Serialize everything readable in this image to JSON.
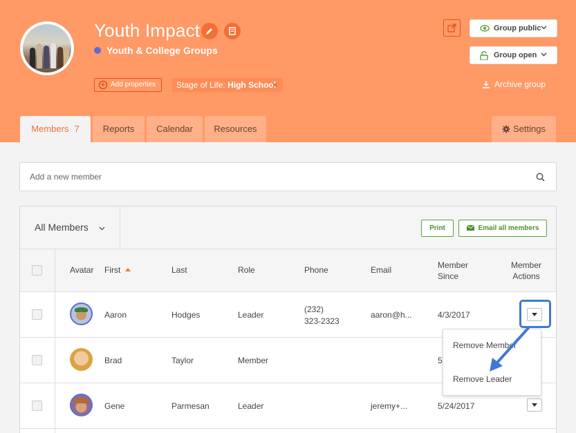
{
  "group": {
    "title": "Youth Impact",
    "category": "Youth & College Groups",
    "add_properties": "Add properties",
    "tag_label": "Stage of Life:",
    "tag_value": "High School",
    "tag_remove": "×",
    "visibility": "Group public",
    "status": "Group open",
    "archive": "Archive group"
  },
  "tabs": [
    {
      "label": "Members",
      "count": "7"
    },
    {
      "label": "Reports"
    },
    {
      "label": "Calendar"
    },
    {
      "label": "Resources"
    },
    {
      "label": "Settings"
    }
  ],
  "add_member_placeholder": "Add a new member",
  "toolbar": {
    "filter": "All Members",
    "print": "Print",
    "email_all": "Email all members"
  },
  "columns": {
    "avatar": "Avatar",
    "first": "First",
    "last": "Last",
    "role": "Role",
    "phone": "Phone",
    "email": "Email",
    "member_since_1": "Member",
    "member_since_2": "Since",
    "actions_1": "Member",
    "actions_2": "Actions"
  },
  "rows": [
    {
      "first": "Aaron",
      "last": "Hodges",
      "role": "Leader",
      "phone_1": "(232)",
      "phone_2": "323-2323",
      "email": "aaron@h...",
      "since": "4/3/2017"
    },
    {
      "first": "Brad",
      "last": "Taylor",
      "role": "Member",
      "phone_1": "",
      "phone_2": "",
      "email": "",
      "since": "5"
    },
    {
      "first": "Gene",
      "last": "Parmesan",
      "role": "Leader",
      "phone_1": "",
      "phone_2": "",
      "email": "jeremy+...",
      "since": "5/24/2017"
    }
  ],
  "actions_menu": [
    "Remove Member",
    "Remove Leader"
  ],
  "colors": {
    "header": "#ff9966",
    "accent": "#f26f36",
    "green": "#4d8f31",
    "highlight": "#3f78d8"
  }
}
